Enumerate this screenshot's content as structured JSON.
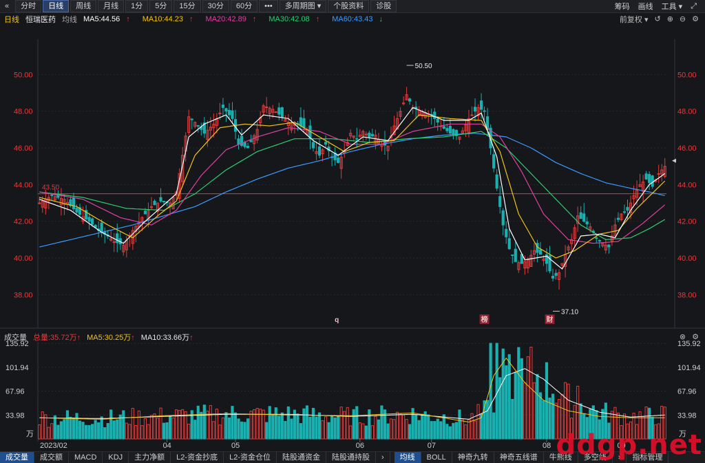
{
  "toolbar": {
    "back_icon": "chevron-left-icon",
    "periods": [
      "分时",
      "日线",
      "周线",
      "月线",
      "1分",
      "5分",
      "15分",
      "30分",
      "60分",
      "•••",
      "多周期图 ▾",
      "个股资料",
      "诊股"
    ],
    "active_period": "日线",
    "right": [
      "筹码",
      "画线",
      "工具 ▾"
    ],
    "expand_icon": "expand-icon"
  },
  "main_header": {
    "period": "日线",
    "stock_name": "恒瑞医药",
    "line_type": "均线",
    "ma": [
      {
        "label": "MA5:44.56",
        "arrow": "↑",
        "color": "#ffffff"
      },
      {
        "label": "MA10:44.23",
        "arrow": "↑",
        "color": "#f0c419"
      },
      {
        "label": "MA20:42.89",
        "arrow": "↑",
        "color": "#e040a0"
      },
      {
        "label": "MA30:42.08",
        "arrow": "↑",
        "color": "#2ecc71"
      },
      {
        "label": "MA60:43.43",
        "arrow": "↓",
        "color": "#3b9bff"
      }
    ],
    "right_label": "前复权 ▾"
  },
  "volume_header": {
    "title": "成交量",
    "total": "总量:35.72万",
    "total_arrow": "↑",
    "ma5": "MA5:30.25万",
    "ma5_arrow": "↑",
    "ma10": "MA10:33.66万",
    "ma10_arrow": "↑"
  },
  "bottom_tabs": [
    "成交量",
    "成交额",
    "MACD",
    "KDJ",
    "主力净额",
    "L2-资金抄底",
    "L2-资金仓位",
    "陆股通资金",
    "陆股通持股",
    "›",
    "均线",
    "BOLL",
    "神奇九转",
    "神奇五线谱",
    "牛熊线",
    "多空线",
    "›",
    "指标管理"
  ],
  "active_tabs": [
    "成交量",
    "均线"
  ],
  "watermark": "ddgp.net",
  "chart_data": {
    "type": "candlestick",
    "start_label": "2023/02",
    "month_labels": [
      "04",
      "05",
      "06",
      "07",
      "08",
      "09"
    ],
    "price_axis": {
      "ticks": [
        50.0,
        48.0,
        46.0,
        44.0,
        42.0,
        40.0,
        38.0
      ],
      "range": [
        37.0,
        51.1
      ]
    },
    "volume_axis": {
      "ticks": [
        "135.92",
        "101.94",
        "67.96",
        "33.98"
      ],
      "unit": "万",
      "range": [
        0,
        136
      ]
    },
    "reference_line": {
      "value": 43.5,
      "label": "43.50"
    },
    "annotations": {
      "max": {
        "label": "50.50",
        "value": 50.5
      },
      "min": {
        "label": "37.10",
        "value": 37.1
      }
    },
    "event_markers": [
      {
        "text": "q",
        "style": "plain"
      },
      {
        "text": "榜",
        "style": "box"
      },
      {
        "text": "财",
        "style": "box"
      }
    ],
    "colors": {
      "up": "#e53b3b",
      "down": "#1ab0b0",
      "ma5": "#ffffff",
      "ma10": "#f0c419",
      "ma20": "#e040a0",
      "ma30": "#2ecc71",
      "ma60": "#3b9bff",
      "grid": "#2a2b30",
      "ref": "#e53b3b"
    },
    "anchors": [
      [
        0,
        43.0
      ],
      [
        4,
        43.4
      ],
      [
        8,
        43.2
      ],
      [
        12,
        42.5
      ],
      [
        16,
        42.0
      ],
      [
        19,
        41.5
      ],
      [
        22,
        41.2
      ],
      [
        24,
        40.9
      ],
      [
        27,
        40.7
      ],
      [
        30,
        41.5
      ],
      [
        33,
        42.2
      ],
      [
        36,
        42.8
      ],
      [
        39,
        43.1
      ],
      [
        42,
        43.0
      ],
      [
        44,
        43.6
      ],
      [
        46,
        45.6
      ],
      [
        48,
        47.7
      ],
      [
        50,
        47.4
      ],
      [
        53,
        46.8
      ],
      [
        56,
        47.3
      ],
      [
        59,
        48.2
      ],
      [
        62,
        47.6
      ],
      [
        64,
        46.2
      ],
      [
        67,
        46.0
      ],
      [
        70,
        47.0
      ],
      [
        72,
        48.3
      ],
      [
        75,
        48.1
      ],
      [
        78,
        47.7
      ],
      [
        80,
        47.4
      ],
      [
        83,
        47.3
      ],
      [
        86,
        47.0
      ],
      [
        88,
        46.0
      ],
      [
        90,
        45.6
      ],
      [
        92,
        46.2
      ],
      [
        94,
        45.5
      ],
      [
        96,
        45.2
      ],
      [
        98,
        45.8
      ],
      [
        100,
        46.8
      ],
      [
        102,
        46.5
      ],
      [
        104,
        46.9
      ],
      [
        106,
        46.6
      ],
      [
        108,
        46.7
      ],
      [
        110,
        46.2
      ],
      [
        112,
        46.1
      ],
      [
        114,
        47.2
      ],
      [
        116,
        48.0
      ],
      [
        118,
        48.9
      ],
      [
        120,
        48.2
      ],
      [
        123,
        48.0
      ],
      [
        126,
        47.8
      ],
      [
        129,
        47.2
      ],
      [
        132,
        46.8
      ],
      [
        135,
        46.6
      ],
      [
        138,
        47.6
      ],
      [
        141,
        48.2
      ],
      [
        143,
        48.0
      ],
      [
        145,
        46.0
      ],
      [
        147,
        43.8
      ],
      [
        149,
        41.8
      ],
      [
        151,
        40.5
      ],
      [
        153,
        39.8
      ],
      [
        155,
        39.7
      ],
      [
        157,
        39.9
      ],
      [
        159,
        40.4
      ],
      [
        161,
        40.2
      ],
      [
        163,
        39.7
      ],
      [
        165,
        38.9
      ],
      [
        167,
        39.2
      ],
      [
        169,
        40.2
      ],
      [
        171,
        41.0
      ],
      [
        173,
        42.3
      ],
      [
        175,
        42.0
      ],
      [
        177,
        41.7
      ],
      [
        179,
        41.1
      ],
      [
        181,
        40.8
      ],
      [
        183,
        40.6
      ],
      [
        185,
        41.8
      ],
      [
        187,
        42.4
      ],
      [
        189,
        42.6
      ],
      [
        191,
        43.4
      ],
      [
        193,
        44.0
      ],
      [
        195,
        44.3
      ],
      [
        197,
        43.9
      ],
      [
        199,
        44.6
      ],
      [
        201,
        45.0
      ]
    ],
    "ma_series": {
      "ma5": [
        [
          0,
          43.2
        ],
        [
          10,
          42.6
        ],
        [
          20,
          41.4
        ],
        [
          27,
          40.8
        ],
        [
          34,
          42.0
        ],
        [
          40,
          42.9
        ],
        [
          44,
          43.5
        ],
        [
          48,
          46.6
        ],
        [
          53,
          47.3
        ],
        [
          60,
          47.8
        ],
        [
          65,
          46.7
        ],
        [
          72,
          47.8
        ],
        [
          80,
          47.6
        ],
        [
          88,
          46.4
        ],
        [
          96,
          45.6
        ],
        [
          104,
          46.6
        ],
        [
          112,
          46.4
        ],
        [
          120,
          48.2
        ],
        [
          130,
          47.5
        ],
        [
          138,
          47.5
        ],
        [
          142,
          47.9
        ],
        [
          147,
          45.5
        ],
        [
          151,
          41.6
        ],
        [
          156,
          39.9
        ],
        [
          163,
          40.1
        ],
        [
          168,
          39.4
        ],
        [
          174,
          41.2
        ],
        [
          180,
          41.3
        ],
        [
          185,
          41.1
        ],
        [
          190,
          42.6
        ],
        [
          196,
          44.0
        ],
        [
          201,
          44.6
        ]
      ],
      "ma10": [
        [
          0,
          43.3
        ],
        [
          12,
          42.8
        ],
        [
          22,
          41.8
        ],
        [
          30,
          41.1
        ],
        [
          38,
          42.3
        ],
        [
          44,
          43.1
        ],
        [
          50,
          45.6
        ],
        [
          58,
          47.1
        ],
        [
          66,
          47.3
        ],
        [
          74,
          47.2
        ],
        [
          82,
          47.4
        ],
        [
          90,
          46.6
        ],
        [
          98,
          45.8
        ],
        [
          106,
          46.3
        ],
        [
          114,
          46.4
        ],
        [
          122,
          47.8
        ],
        [
          132,
          47.6
        ],
        [
          142,
          47.5
        ],
        [
          148,
          45.8
        ],
        [
          154,
          42.4
        ],
        [
          160,
          40.6
        ],
        [
          166,
          40.0
        ],
        [
          172,
          40.4
        ],
        [
          180,
          41.3
        ],
        [
          186,
          41.5
        ],
        [
          192,
          42.7
        ],
        [
          201,
          44.2
        ]
      ],
      "ma20": [
        [
          0,
          43.6
        ],
        [
          14,
          43.2
        ],
        [
          26,
          42.2
        ],
        [
          36,
          41.8
        ],
        [
          44,
          42.6
        ],
        [
          52,
          44.5
        ],
        [
          60,
          45.9
        ],
        [
          70,
          46.6
        ],
        [
          80,
          47.1
        ],
        [
          90,
          46.9
        ],
        [
          100,
          46.2
        ],
        [
          110,
          46.2
        ],
        [
          120,
          46.9
        ],
        [
          132,
          47.3
        ],
        [
          142,
          47.3
        ],
        [
          148,
          46.6
        ],
        [
          155,
          44.7
        ],
        [
          162,
          42.4
        ],
        [
          170,
          41.0
        ],
        [
          178,
          40.8
        ],
        [
          186,
          40.9
        ],
        [
          194,
          41.9
        ],
        [
          201,
          42.9
        ]
      ],
      "ma30": [
        [
          0,
          43.6
        ],
        [
          14,
          43.3
        ],
        [
          28,
          42.7
        ],
        [
          40,
          42.6
        ],
        [
          50,
          43.5
        ],
        [
          60,
          44.8
        ],
        [
          70,
          45.8
        ],
        [
          82,
          46.5
        ],
        [
          94,
          46.5
        ],
        [
          106,
          46.3
        ],
        [
          118,
          46.5
        ],
        [
          130,
          46.6
        ],
        [
          142,
          46.9
        ],
        [
          150,
          46.0
        ],
        [
          158,
          44.6
        ],
        [
          166,
          43.2
        ],
        [
          174,
          41.8
        ],
        [
          182,
          41.0
        ],
        [
          190,
          41.1
        ],
        [
          196,
          41.6
        ],
        [
          201,
          42.1
        ]
      ],
      "ma60": [
        [
          0,
          40.6
        ],
        [
          10,
          41.0
        ],
        [
          20,
          41.4
        ],
        [
          30,
          41.8
        ],
        [
          40,
          42.3
        ],
        [
          50,
          42.8
        ],
        [
          60,
          43.6
        ],
        [
          70,
          44.3
        ],
        [
          80,
          44.9
        ],
        [
          90,
          45.3
        ],
        [
          100,
          45.8
        ],
        [
          110,
          46.2
        ],
        [
          120,
          46.5
        ],
        [
          130,
          46.7
        ],
        [
          140,
          46.8
        ],
        [
          150,
          46.6
        ],
        [
          158,
          46.0
        ],
        [
          166,
          45.2
        ],
        [
          174,
          44.6
        ],
        [
          182,
          44.1
        ],
        [
          190,
          43.8
        ],
        [
          196,
          43.6
        ],
        [
          201,
          43.4
        ]
      ]
    },
    "volume_ma": {
      "ma5": [
        [
          0,
          30
        ],
        [
          20,
          28
        ],
        [
          40,
          33
        ],
        [
          60,
          36
        ],
        [
          80,
          34
        ],
        [
          100,
          33
        ],
        [
          120,
          37
        ],
        [
          138,
          24
        ],
        [
          142,
          30
        ],
        [
          146,
          90
        ],
        [
          150,
          115
        ],
        [
          156,
          80
        ],
        [
          162,
          55
        ],
        [
          170,
          40
        ],
        [
          180,
          32
        ],
        [
          190,
          30
        ],
        [
          201,
          30
        ]
      ],
      "ma10": [
        [
          0,
          30
        ],
        [
          20,
          29
        ],
        [
          40,
          32
        ],
        [
          60,
          35
        ],
        [
          80,
          35
        ],
        [
          100,
          32
        ],
        [
          120,
          35
        ],
        [
          138,
          28
        ],
        [
          144,
          40
        ],
        [
          150,
          90
        ],
        [
          156,
          100
        ],
        [
          162,
          85
        ],
        [
          170,
          55
        ],
        [
          180,
          38
        ],
        [
          190,
          31
        ],
        [
          201,
          34
        ]
      ]
    },
    "volume_spikes": [
      [
        145,
        136
      ],
      [
        147,
        136
      ],
      [
        149,
        128
      ],
      [
        151,
        120
      ],
      [
        153,
        95
      ],
      [
        156,
        80
      ],
      [
        173,
        75
      ]
    ]
  }
}
